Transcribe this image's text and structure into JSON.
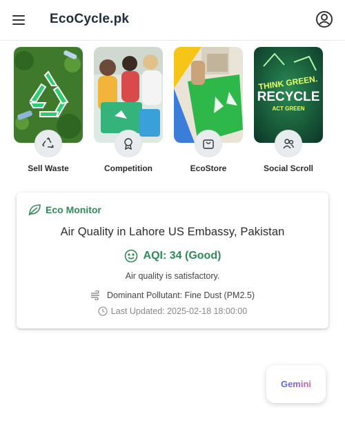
{
  "header": {
    "brand": "EcoCycle.pk",
    "menu_icon": "menu-icon",
    "account_icon": "account-circle-icon"
  },
  "categories": [
    {
      "label": "Sell Waste",
      "icon": "recycle-icon"
    },
    {
      "label": "Competition",
      "icon": "award-icon"
    },
    {
      "label": "EcoStore",
      "icon": "shopping-bag-icon"
    },
    {
      "label": "Social Scroll",
      "icon": "users-icon"
    }
  ],
  "eco_monitor": {
    "heading": "Eco Monitor",
    "title": "Air Quality in Lahore US Embassy, Pakistan",
    "aqi": "AQI: 34 (Good)",
    "status": "Air quality is satisfactory.",
    "pollutant": "Dominant Pollutant: Fine Dust (PM2.5)",
    "updated": "Last Updated: 2025-02-18 18:00:00"
  },
  "poster_text": {
    "line1": "THINK GREEN.",
    "line2": "RECYCLE",
    "line3": "ACT GREEN"
  },
  "gemini": {
    "label": "Gemini"
  },
  "colors": {
    "accent_green": "#2e8b57",
    "brand_text": "#1f2d3d"
  }
}
